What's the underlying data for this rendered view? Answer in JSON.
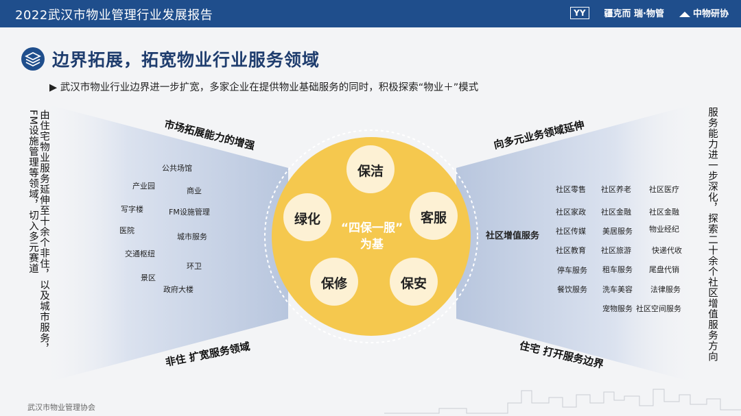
{
  "header": {
    "title": "2022武汉市物业管理行业发展报告",
    "logos": [
      "YY",
      "疆克而 瑞·物管",
      "中物研协"
    ]
  },
  "page": {
    "title": "边界拓展，拓宽物业行业服务领域",
    "subtitle": "▶ 武汉市物业行业边界进一步扩宽，多家企业在提供物业基础服务的同时，积极探索“物业＋”模式"
  },
  "center": {
    "core_line1": "“四保一服”",
    "core_line2": "为基",
    "nodes": [
      "保洁",
      "客服",
      "保安",
      "保修",
      "绿化"
    ]
  },
  "left": {
    "top_heading": "市场拓展能力的增强",
    "bottom_heading": "非住 扩宽服务领域",
    "vertical_text": "由住宅物业服务延伸至十余个非住，以及城市服务，FM设施管理等领域，切入多元赛道",
    "items": [
      "公共场馆",
      "产业园",
      "商业",
      "写字楼",
      "FM设施管理",
      "医院",
      "城市服务",
      "交通枢纽",
      "环卫",
      "景区",
      "政府大楼"
    ]
  },
  "right": {
    "top_heading": "向多元业务领域延伸",
    "bottom_heading": "住宅 打开服务边界",
    "label": "社区增值服务",
    "vertical_text": "服务能力进一步深化，探索二十余个社区增值服务方向",
    "items": [
      "社区零售",
      "社区养老",
      "社区医疗",
      "社区家政",
      "社区金融",
      "社区金融",
      "社区传媒",
      "美居服务",
      "物业经纪",
      "社区教育",
      "社区旅游",
      "快递代收",
      "停车服务",
      "租车服务",
      "尾盘代销",
      "餐饮服务",
      "洗车美容",
      "法律服务",
      "宠物服务",
      "社区空间服务"
    ]
  },
  "footer": {
    "text": "武汉市物业管理协会"
  },
  "colors": {
    "header": "#1f4e8c",
    "core": "#f5c84e",
    "node": "#fdf1d4",
    "fan": "#c9d3e6"
  }
}
